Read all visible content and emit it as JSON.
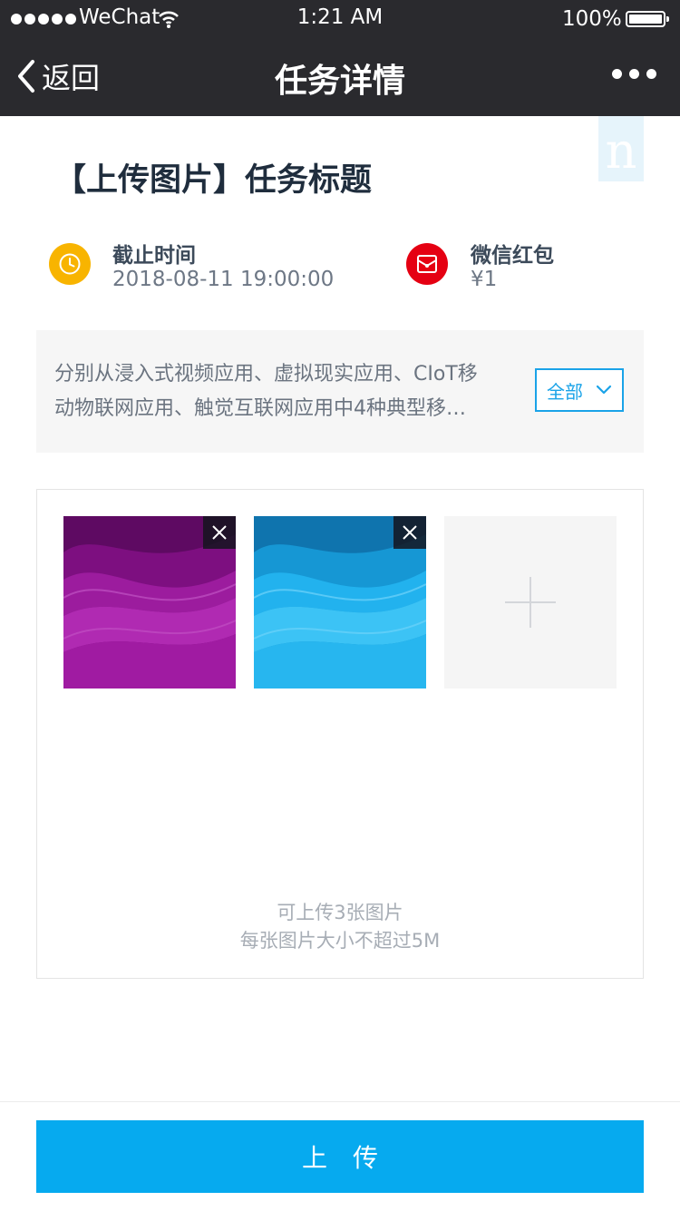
{
  "status_bar": {
    "carrier": "WeChat",
    "time": "1:21 AM",
    "battery": "100%"
  },
  "nav": {
    "back_label": "返回",
    "title": "任务详情"
  },
  "badge": "n",
  "task": {
    "title": "【上传图片】任务标题",
    "deadline_label": "截止时间",
    "deadline_value": "2018-08-11  19:00:00",
    "reward_label": "微信红包",
    "reward_value": "¥1"
  },
  "description": {
    "line1": "分别从浸入式视频应用、虚拟现实应用、CIoT移",
    "line2": "动物联网应用、触觉互联网应用中4种典型移…",
    "expand_label": "全部"
  },
  "upload": {
    "hint_count": "可上传3张图片",
    "hint_size": "每张图片大小不超过5M"
  },
  "submit_label": "上传",
  "colors": {
    "nav_bg": "#2a2a2e",
    "accent": "#06aaef",
    "deadline_icon": "#f8b400",
    "reward_icon": "#e50012"
  }
}
